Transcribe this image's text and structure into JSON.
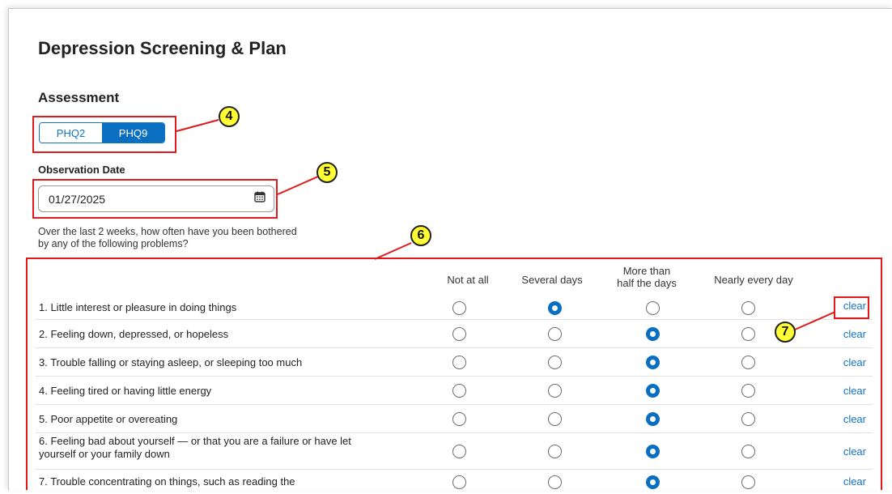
{
  "page": {
    "title": "Depression Screening & Plan"
  },
  "assessment": {
    "section_title": "Assessment",
    "toggle": [
      {
        "label": "PHQ2",
        "selected": false
      },
      {
        "label": "PHQ9",
        "selected": true
      }
    ]
  },
  "observation": {
    "label": "Observation Date",
    "value": "01/27/2025",
    "icon": "calendar-icon"
  },
  "question": "Over the last 2 weeks, how often have you been bothered by any of the following problems?",
  "columns": [
    "Not at all",
    "Several days",
    "More than\nhalf the days",
    "Nearly every day"
  ],
  "clear_label": "clear",
  "items": [
    {
      "label": "1. Little interest or pleasure in doing things",
      "selected": 1
    },
    {
      "label": "2. Feeling down, depressed, or hopeless",
      "selected": 2
    },
    {
      "label": "3. Trouble falling or staying asleep, or sleeping too much",
      "selected": 2
    },
    {
      "label": "4. Feeling tired or having little energy",
      "selected": 2
    },
    {
      "label": "5. Poor appetite or overeating",
      "selected": 2
    },
    {
      "label": "6. Feeling bad about yourself — or that you are a failure or have let yourself or your family down",
      "selected": 2
    },
    {
      "label": "7. Trouble concentrating on things, such as reading the",
      "selected": 2
    }
  ],
  "annotations": [
    "4",
    "5",
    "6",
    "7"
  ],
  "colors": {
    "accent": "#0a6fc0",
    "annotation_border": "#e01a1a",
    "badge_fill": "#ffff33"
  }
}
